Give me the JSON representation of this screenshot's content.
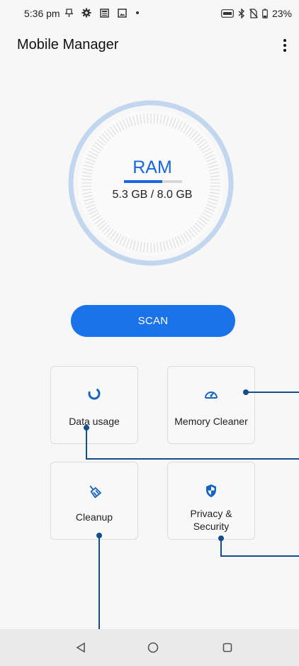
{
  "status_bar": {
    "time": "5:36 pm",
    "battery": "23%",
    "icons": [
      "pin-icon",
      "gear-icon",
      "news-icon",
      "gallery-icon",
      "dot-icon",
      "auto-brightness-icon",
      "bluetooth-icon",
      "no-sim-icon",
      "battery-icon"
    ]
  },
  "app": {
    "title": "Mobile Manager",
    "menu_icon": "more-vert-icon"
  },
  "ram": {
    "label": "RAM",
    "value": "5.3 GB / 8.0 GB",
    "usage_fraction": 0.66
  },
  "scan_button": {
    "label": "SCAN"
  },
  "tiles": [
    {
      "label": "Data usage",
      "icon": "data-usage-icon"
    },
    {
      "label": "Memory Cleaner",
      "icon": "speedometer-icon"
    },
    {
      "label": "Cleanup",
      "icon": "broom-icon"
    },
    {
      "label": "Privacy &\nSecurity",
      "icon": "shield-icon"
    }
  ],
  "nav": {
    "back_icon": "back-triangle-icon",
    "home_icon": "home-circle-icon",
    "recents_icon": "recents-square-icon"
  },
  "colors": {
    "accent": "#1a73e8",
    "ram_text": "#1768e0",
    "ring": "#bfd4ef",
    "callout": "#134f8f",
    "background": "#f7f7f7"
  }
}
